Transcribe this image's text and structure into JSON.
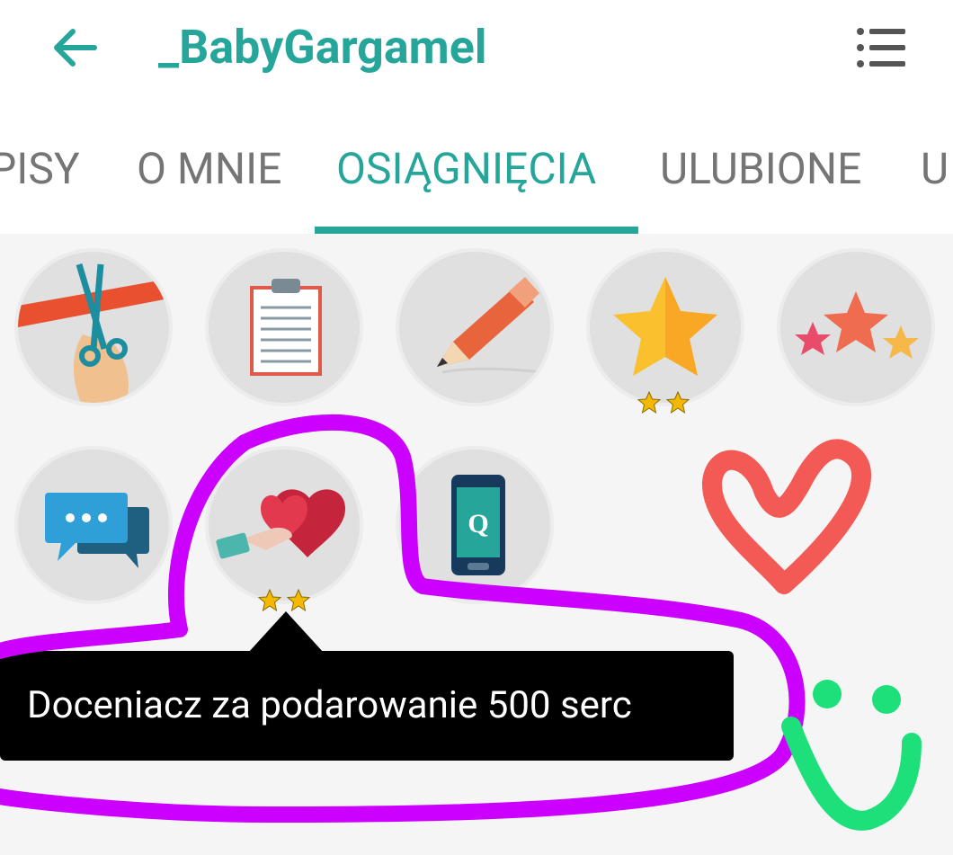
{
  "header": {
    "title": "_BabyGargamel",
    "back_icon": "arrow-left-icon",
    "menu_icon": "list-menu-icon"
  },
  "tabs": [
    {
      "label": "PISY",
      "active": false
    },
    {
      "label": "O MNIE",
      "active": false
    },
    {
      "label": "OSIĄGNIĘCIA",
      "active": true
    },
    {
      "label": "ULUBIONE",
      "active": false
    },
    {
      "label": "U",
      "active": false
    }
  ],
  "badges": [
    {
      "icon": "ribbon-cutting-scissors-icon",
      "stars": 0
    },
    {
      "icon": "clipboard-checklist-icon",
      "stars": 0
    },
    {
      "icon": "pencil-icon",
      "stars": 0
    },
    {
      "icon": "gold-star-icon",
      "stars": 2
    },
    {
      "icon": "three-stars-icon",
      "stars": 0
    },
    {
      "icon": "chat-bubbles-icon",
      "stars": 0
    },
    {
      "icon": "hand-giving-heart-icon",
      "stars": 2
    },
    {
      "icon": "phone-q-icon",
      "stars": 0
    }
  ],
  "tooltip": {
    "text": "Doceniacz za podarowanie 500 serc"
  },
  "colors": {
    "accent": "#26a69a",
    "tab_inactive": "#757575",
    "annotation_purple": "#cc00ff",
    "annotation_red": "#f45a55",
    "annotation_green": "#1ee07a"
  }
}
